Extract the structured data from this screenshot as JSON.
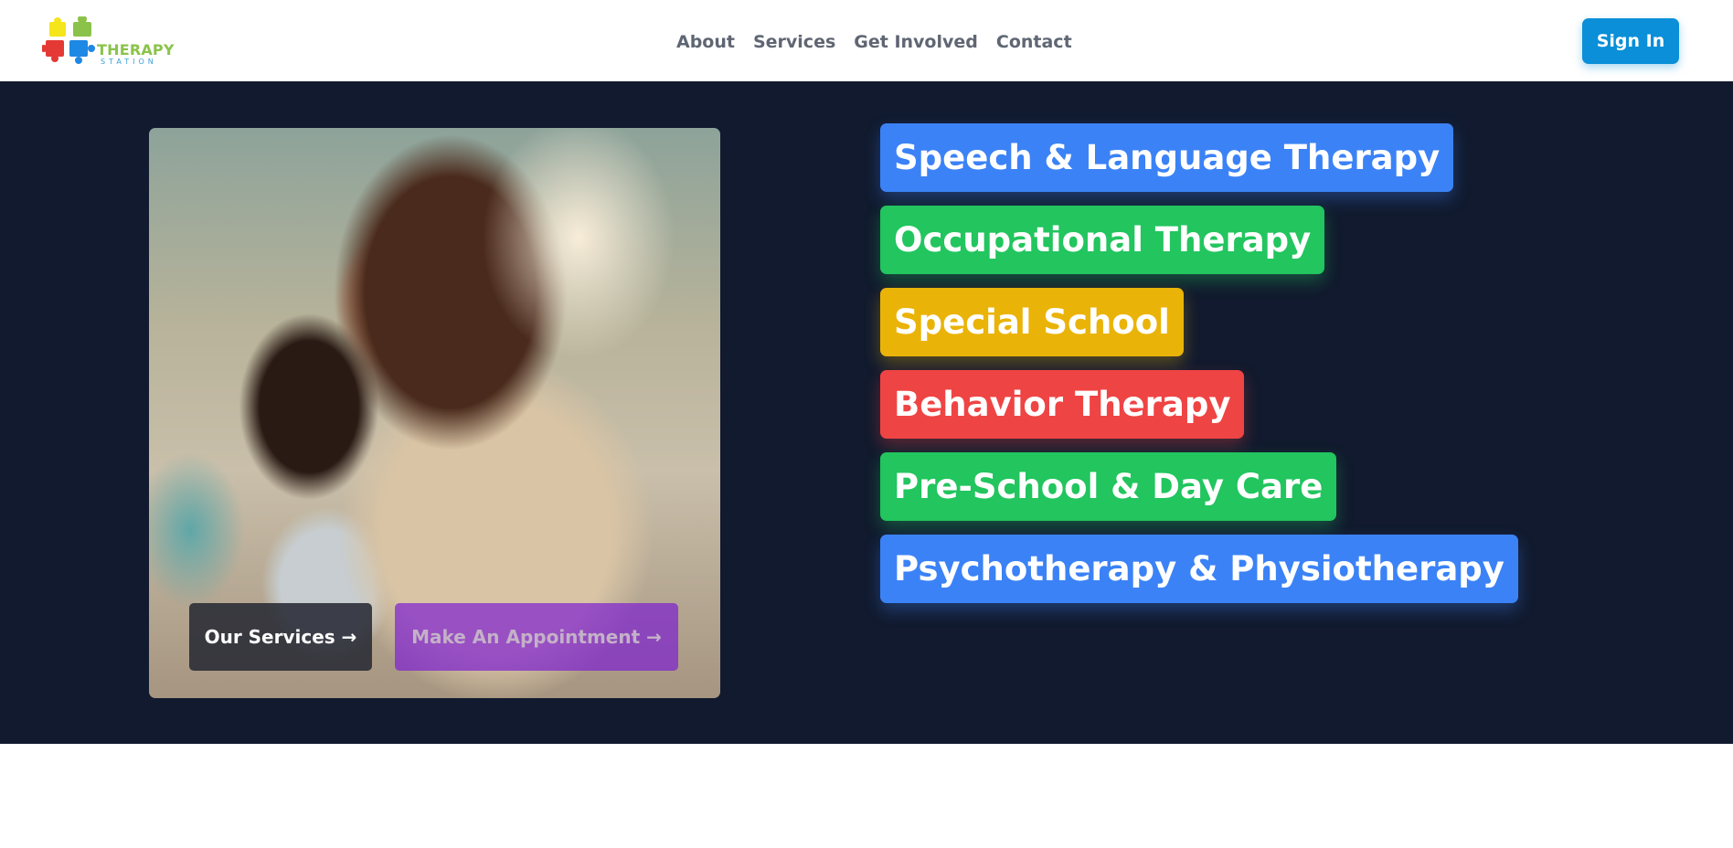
{
  "header": {
    "logo": {
      "name": "THERAPY",
      "sub": "STATION"
    },
    "nav": [
      "About",
      "Services",
      "Get Involved",
      "Contact"
    ],
    "sign_in": "Sign In"
  },
  "hero": {
    "image_alt": "Mother and child",
    "buttons": {
      "services": "Our Services →",
      "appointment": "Make An Appointment →"
    },
    "tags": [
      {
        "label": "Speech & Language Therapy",
        "color": "#3b82f6"
      },
      {
        "label": "Occupational Therapy",
        "color": "#22c55e"
      },
      {
        "label": "Special School",
        "color": "#eab308"
      },
      {
        "label": "Behavior Therapy",
        "color": "#ef4444"
      },
      {
        "label": "Pre-School & Day Care",
        "color": "#22c55e"
      },
      {
        "label": "Psychotherapy & Physiotherapy",
        "color": "#3b82f6"
      }
    ]
  },
  "colors": {
    "hero_bg": "#111a2e",
    "sign_in": "#0a8fd8"
  }
}
